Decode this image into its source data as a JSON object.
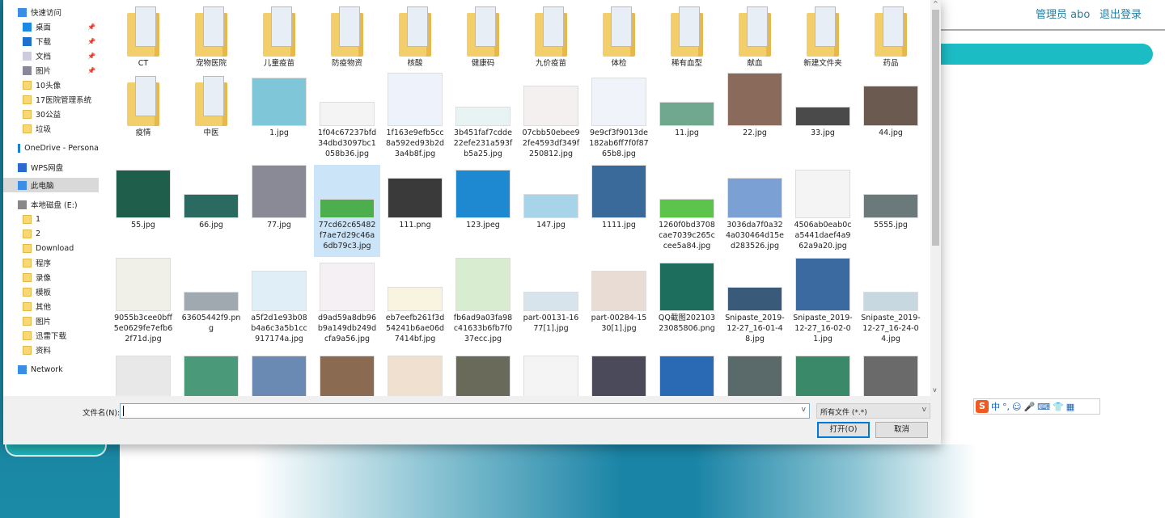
{
  "header": {
    "user": "管理员 abo",
    "logout": "退出登录"
  },
  "ime": {
    "logo": "S",
    "items": [
      "中",
      "°,",
      "☺",
      "🎤",
      "⌨",
      "👕",
      "▦"
    ]
  },
  "sidebar": {
    "quick_access": "快速访问",
    "pinned": [
      "桌面",
      "下载",
      "文档",
      "图片"
    ],
    "folders": [
      "10头像",
      "17医院管理系统",
      "30公益",
      "垃圾"
    ],
    "onedrive": "OneDrive - Persona",
    "wps": "WPS网盘",
    "this_pc": "此电脑",
    "drive": "本地磁盘 (E:)",
    "drive_folders": [
      "1",
      "2",
      "Download",
      "程序",
      "录像",
      "模板",
      "其他",
      "图片",
      "迅雷下载",
      "资料"
    ],
    "network": "Network"
  },
  "files": [
    {
      "name": "CT",
      "kind": "folder"
    },
    {
      "name": "宠物医院",
      "kind": "folder"
    },
    {
      "name": "儿童疫苗",
      "kind": "folder"
    },
    {
      "name": "防疫物资",
      "kind": "folder"
    },
    {
      "name": "核酸",
      "kind": "folder"
    },
    {
      "name": "健康码",
      "kind": "folder"
    },
    {
      "name": "九价疫苗",
      "kind": "folder"
    },
    {
      "name": "体检",
      "kind": "folder"
    },
    {
      "name": "稀有血型",
      "kind": "folder"
    },
    {
      "name": "献血",
      "kind": "folder"
    },
    {
      "name": "新建文件夹",
      "kind": "folder"
    },
    {
      "name": "药品",
      "kind": "folder"
    },
    {
      "name": "疫情",
      "kind": "folder"
    },
    {
      "name": "中医",
      "kind": "folder"
    },
    {
      "name": "1.jpg",
      "kind": "image",
      "color": "#7fc6d8"
    },
    {
      "name": "1f04c67237bfd34dbd3097bc1058b36.jpg",
      "kind": "image",
      "color": "#f4f4f4"
    },
    {
      "name": "1f163e9efb5cc8a592ed93b2d3a4b8f.jpg",
      "kind": "image",
      "color": "#eef2fa"
    },
    {
      "name": "3b451faf7cdde22efe231a593fb5a25.jpg",
      "kind": "image",
      "color": "#e8f4f4"
    },
    {
      "name": "07cbb50ebee92fe4593df349f250812.jpg",
      "kind": "image",
      "color": "#f5f0f0"
    },
    {
      "name": "9e9cf3f9013de182ab6ff7f0f8765b8.jpg",
      "kind": "image",
      "color": "#f0f4fa"
    },
    {
      "name": "11.jpg",
      "kind": "image",
      "color": "#6fa88e"
    },
    {
      "name": "22.jpg",
      "kind": "image",
      "color": "#8a6a5a"
    },
    {
      "name": "33.jpg",
      "kind": "image",
      "color": "#4a4a4a"
    },
    {
      "name": "44.jpg",
      "kind": "image",
      "color": "#6a5a50"
    },
    {
      "name": "55.jpg",
      "kind": "image",
      "color": "#1e5e4a"
    },
    {
      "name": "66.jpg",
      "kind": "image",
      "color": "#2a6a60"
    },
    {
      "name": "77.jpg",
      "kind": "image",
      "color": "#8a8a96"
    },
    {
      "name": "77cd62c65482f7ae7d29c46a6db79c3.jpg",
      "kind": "image",
      "color": "#4cae4c",
      "selected": true
    },
    {
      "name": "111.png",
      "kind": "image",
      "color": "#3a3a3a"
    },
    {
      "name": "123.jpeg",
      "kind": "image",
      "color": "#1e88d0"
    },
    {
      "name": "147.jpg",
      "kind": "image",
      "color": "#a8d4ea"
    },
    {
      "name": "1111.jpg",
      "kind": "image",
      "color": "#3a6a9a"
    },
    {
      "name": "1260f0bd3708cae7039c265ccee5a84.jpg",
      "kind": "image",
      "color": "#5cc44a"
    },
    {
      "name": "3036da7f0a324a030464d15ed283526.jpg",
      "kind": "image",
      "color": "#7aa0d4"
    },
    {
      "name": "4506ab0eab0ca5441daef4a962a9a20.jpg",
      "kind": "image",
      "color": "#f4f4f4"
    },
    {
      "name": "5555.jpg",
      "kind": "image",
      "color": "#6a7a7a"
    },
    {
      "name": "9055b3cee0bff5e0629fe7efb62f71d.jpg",
      "kind": "image",
      "color": "#f0f0e8"
    },
    {
      "name": "63605442f9.png",
      "kind": "image",
      "color": "#a0a8b0"
    },
    {
      "name": "a5f2d1e93b08b4a6c3a5b1cc917174a.jpg",
      "kind": "image",
      "color": "#e0eef8"
    },
    {
      "name": "d9ad59a8db96b9a149db249dcfa9a56.jpg",
      "kind": "image",
      "color": "#f4f0f4"
    },
    {
      "name": "eb7eefb261f3d54241b6ae06d7414bf.jpg",
      "kind": "image",
      "color": "#f8f4e0"
    },
    {
      "name": "fb6ad9a03fa98c41633b6fb7f037ecc.jpg",
      "kind": "image",
      "color": "#d8ecd0"
    },
    {
      "name": "part-00131-1677[1].jpg",
      "kind": "image",
      "color": "#d8e4ec"
    },
    {
      "name": "part-00284-1530[1].jpg",
      "kind": "image",
      "color": "#e8dcd4"
    },
    {
      "name": "QQ截图20210323085806.png",
      "kind": "image",
      "color": "#1e6e5e"
    },
    {
      "name": "Snipaste_2019-12-27_16-01-48.jpg",
      "kind": "image",
      "color": "#3a5a7a"
    },
    {
      "name": "Snipaste_2019-12-27_16-02-01.jpg",
      "kind": "image",
      "color": "#3a6aa0"
    },
    {
      "name": "Snipaste_2019-12-27_16-24-04.jpg",
      "kind": "image",
      "color": "#c8d8e0"
    },
    {
      "kind": "image",
      "color": "#e8e8e8"
    },
    {
      "kind": "image",
      "color": "#4a9a7a"
    },
    {
      "kind": "image",
      "color": "#6a8ab4"
    },
    {
      "kind": "image",
      "color": "#8a6a50"
    },
    {
      "kind": "image",
      "color": "#f0e0d0"
    },
    {
      "kind": "image",
      "color": "#6a6a5a"
    },
    {
      "kind": "image",
      "color": "#f4f4f4"
    },
    {
      "kind": "image",
      "color": "#4a4a5a"
    },
    {
      "kind": "image",
      "color": "#2a6ab4"
    },
    {
      "kind": "image",
      "color": "#5a6a6a"
    },
    {
      "kind": "image",
      "color": "#3a8a6a"
    },
    {
      "kind": "image",
      "color": "#6a6a6a"
    }
  ],
  "footer": {
    "filename_label": "文件名(N):",
    "filename_value": "",
    "filter": "所有文件 (*.*)",
    "open": "打开(O)",
    "cancel": "取消"
  }
}
